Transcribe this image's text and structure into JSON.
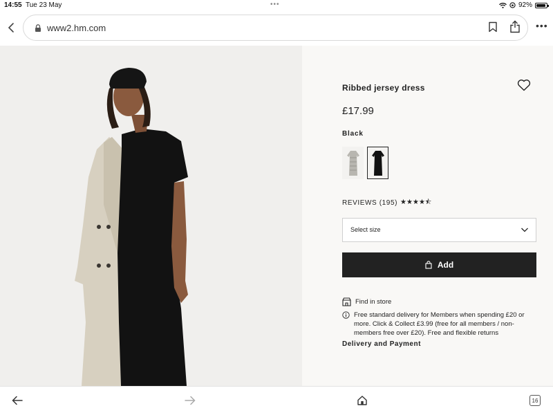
{
  "status": {
    "time": "14:55",
    "date": "Tue 23 May",
    "battery": "92%",
    "battery_level": 0.92
  },
  "browser": {
    "url": "www2.hm.com",
    "tab_count": "16"
  },
  "product": {
    "name": "Ribbed jersey dress",
    "price": "£17.99",
    "color": "Black",
    "swatches": [
      "light-grey-pattern-dress",
      "black-dress"
    ],
    "selected_swatch": "black-dress",
    "reviews_label": "REVIEWS (195)",
    "rating_stars": "★★★★⯪",
    "rating_value": 4.5,
    "size_placeholder": "Select size",
    "add_label": "Add",
    "find_in_store": "Find in store",
    "delivery_text": "Free standard delivery for Members when spending £20 or more. Click & Collect £3.99 (free for all members / non-members free over £20). Free and flexible returns",
    "delivery_heading": "Delivery and Payment"
  },
  "colors": {
    "add_button": "#222222",
    "page_background": "#f9f8f6"
  }
}
